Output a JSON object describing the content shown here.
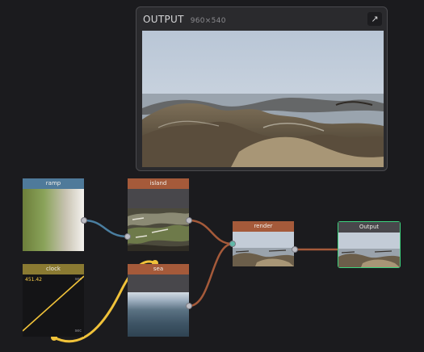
{
  "preview": {
    "title": "OUTPUT",
    "size": "960×540",
    "expand_icon": "↗"
  },
  "nodes": {
    "ramp": {
      "label": "ramp",
      "header_color": "#4f7a9a"
    },
    "island": {
      "label": "island",
      "header_color": "#a55a3a"
    },
    "clock": {
      "label": "clock",
      "header_color": "#8a7a32",
      "value": "451.42",
      "tag_top": "sec",
      "tag_bottom": "sec"
    },
    "sea": {
      "label": "sea",
      "header_color": "#a55a3a"
    },
    "render": {
      "label": "render",
      "header_color": "#a55a3a"
    },
    "output": {
      "label": "Output",
      "header_color": "#48474b",
      "border_color": "#3dd37e"
    }
  },
  "wire_colors": {
    "ramp_to_island": "#4a7ea0",
    "to_render": "#a55a3a",
    "clock_to_sea": "#f0c23a"
  }
}
